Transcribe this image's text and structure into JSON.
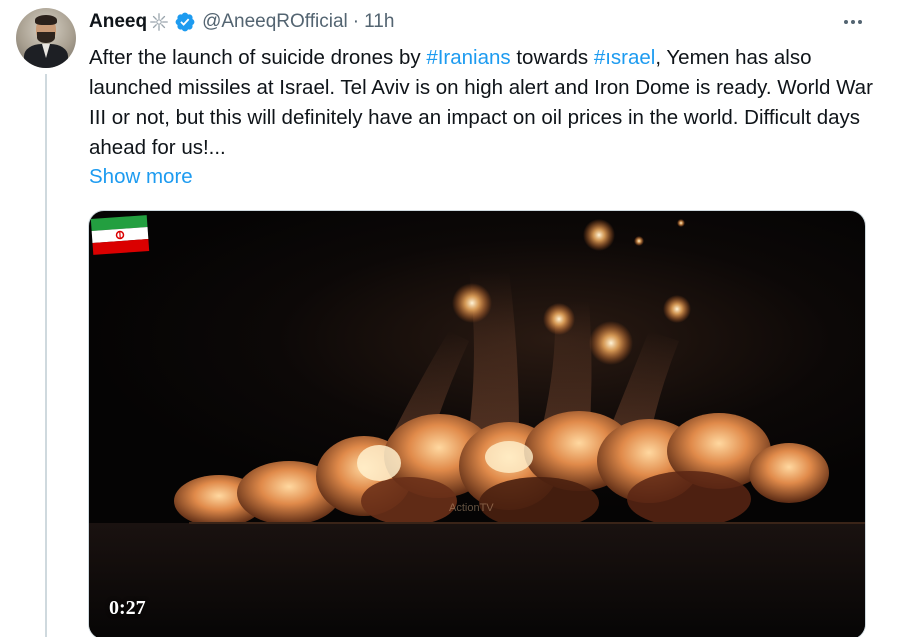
{
  "tweet": {
    "author_name": "Aneeq",
    "handle": "@AneeqROfficial",
    "separator": "·",
    "time": "11h",
    "text_parts": {
      "p1": "After the launch of suicide drones by ",
      "tag1": "#Iranians",
      "p2": " towards ",
      "tag2": "#ısrael",
      "p3": ", Yemen has also launched missiles at Israel. Tel Aviv is on high alert and Iron Dome is ready. World War III or not, but this will definitely have an impact on oil prices in the world. Difficult days ahead for us!..."
    },
    "show_more": "Show more",
    "video": {
      "duration": "0:27",
      "watermark": "ActionTV"
    }
  },
  "colors": {
    "accent": "#1d9bf0",
    "text": "#0f1419",
    "muted": "#536471",
    "thread_line": "#cfd9de"
  },
  "icons": {
    "verified": "verified-badge-icon",
    "sparkle": "sparkle-emoji-icon",
    "more": "more-options-icon",
    "flag": "iran-flag-icon"
  }
}
